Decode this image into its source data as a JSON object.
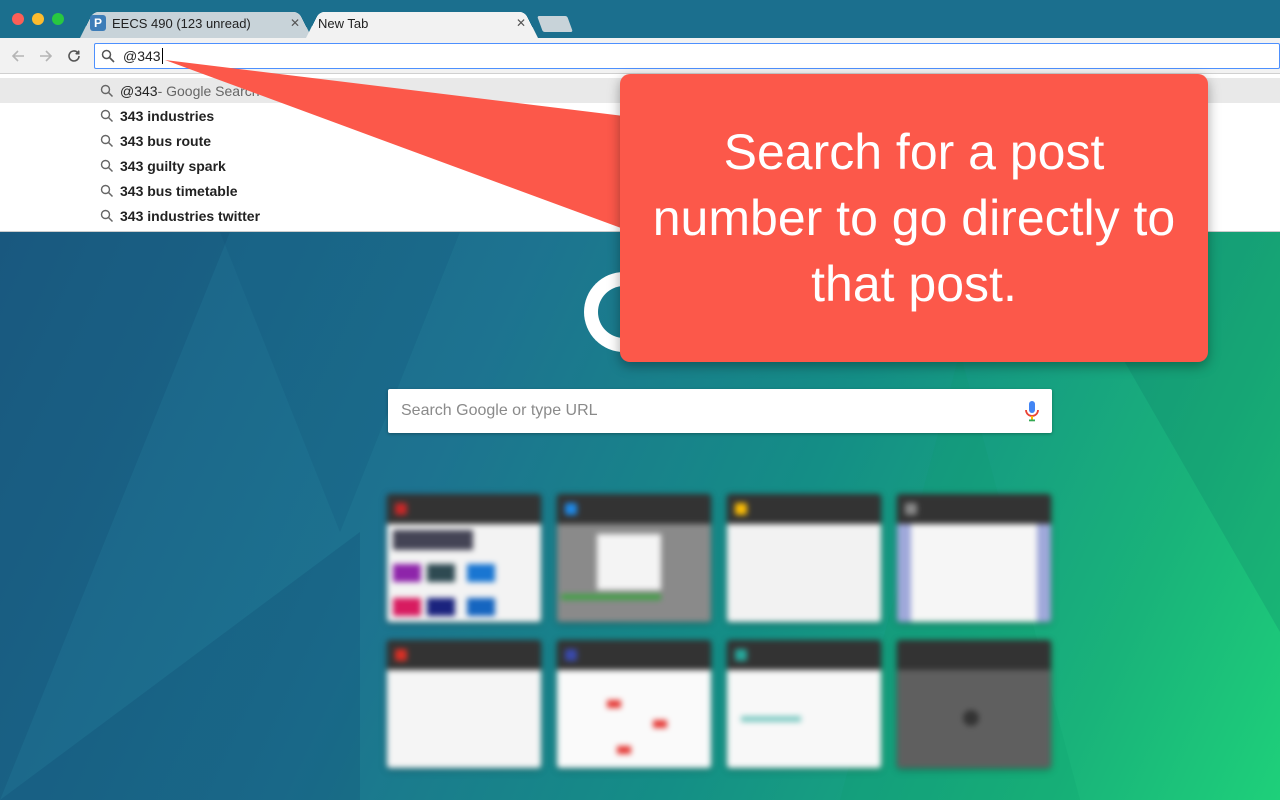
{
  "browser": {
    "tabs": [
      {
        "title": "EECS 490 (123 unread)",
        "favicon": "piazza-icon",
        "active": false
      },
      {
        "title": "New Tab",
        "active": true
      }
    ],
    "omnibox": {
      "value": "@343"
    }
  },
  "suggestions": [
    {
      "bold": "@343",
      "muted": " - Google Search",
      "highlight": true
    },
    {
      "bold": "343 industries",
      "muted": "",
      "highlight": false
    },
    {
      "bold": "343 bus route",
      "muted": "",
      "highlight": false
    },
    {
      "bold": "343 guilty spark",
      "muted": "",
      "highlight": false
    },
    {
      "bold": "343 bus timetable",
      "muted": "",
      "highlight": false
    },
    {
      "bold": "343 industries twitter",
      "muted": "",
      "highlight": false
    }
  ],
  "new_tab": {
    "search_placeholder": "Search Google or type URL"
  },
  "callout": {
    "text": "Search for a post number to go directly to that post."
  },
  "colors": {
    "callout": "#fc584a",
    "tabstrip": "#1b6f8e",
    "focus_ring": "#4d90fe"
  }
}
